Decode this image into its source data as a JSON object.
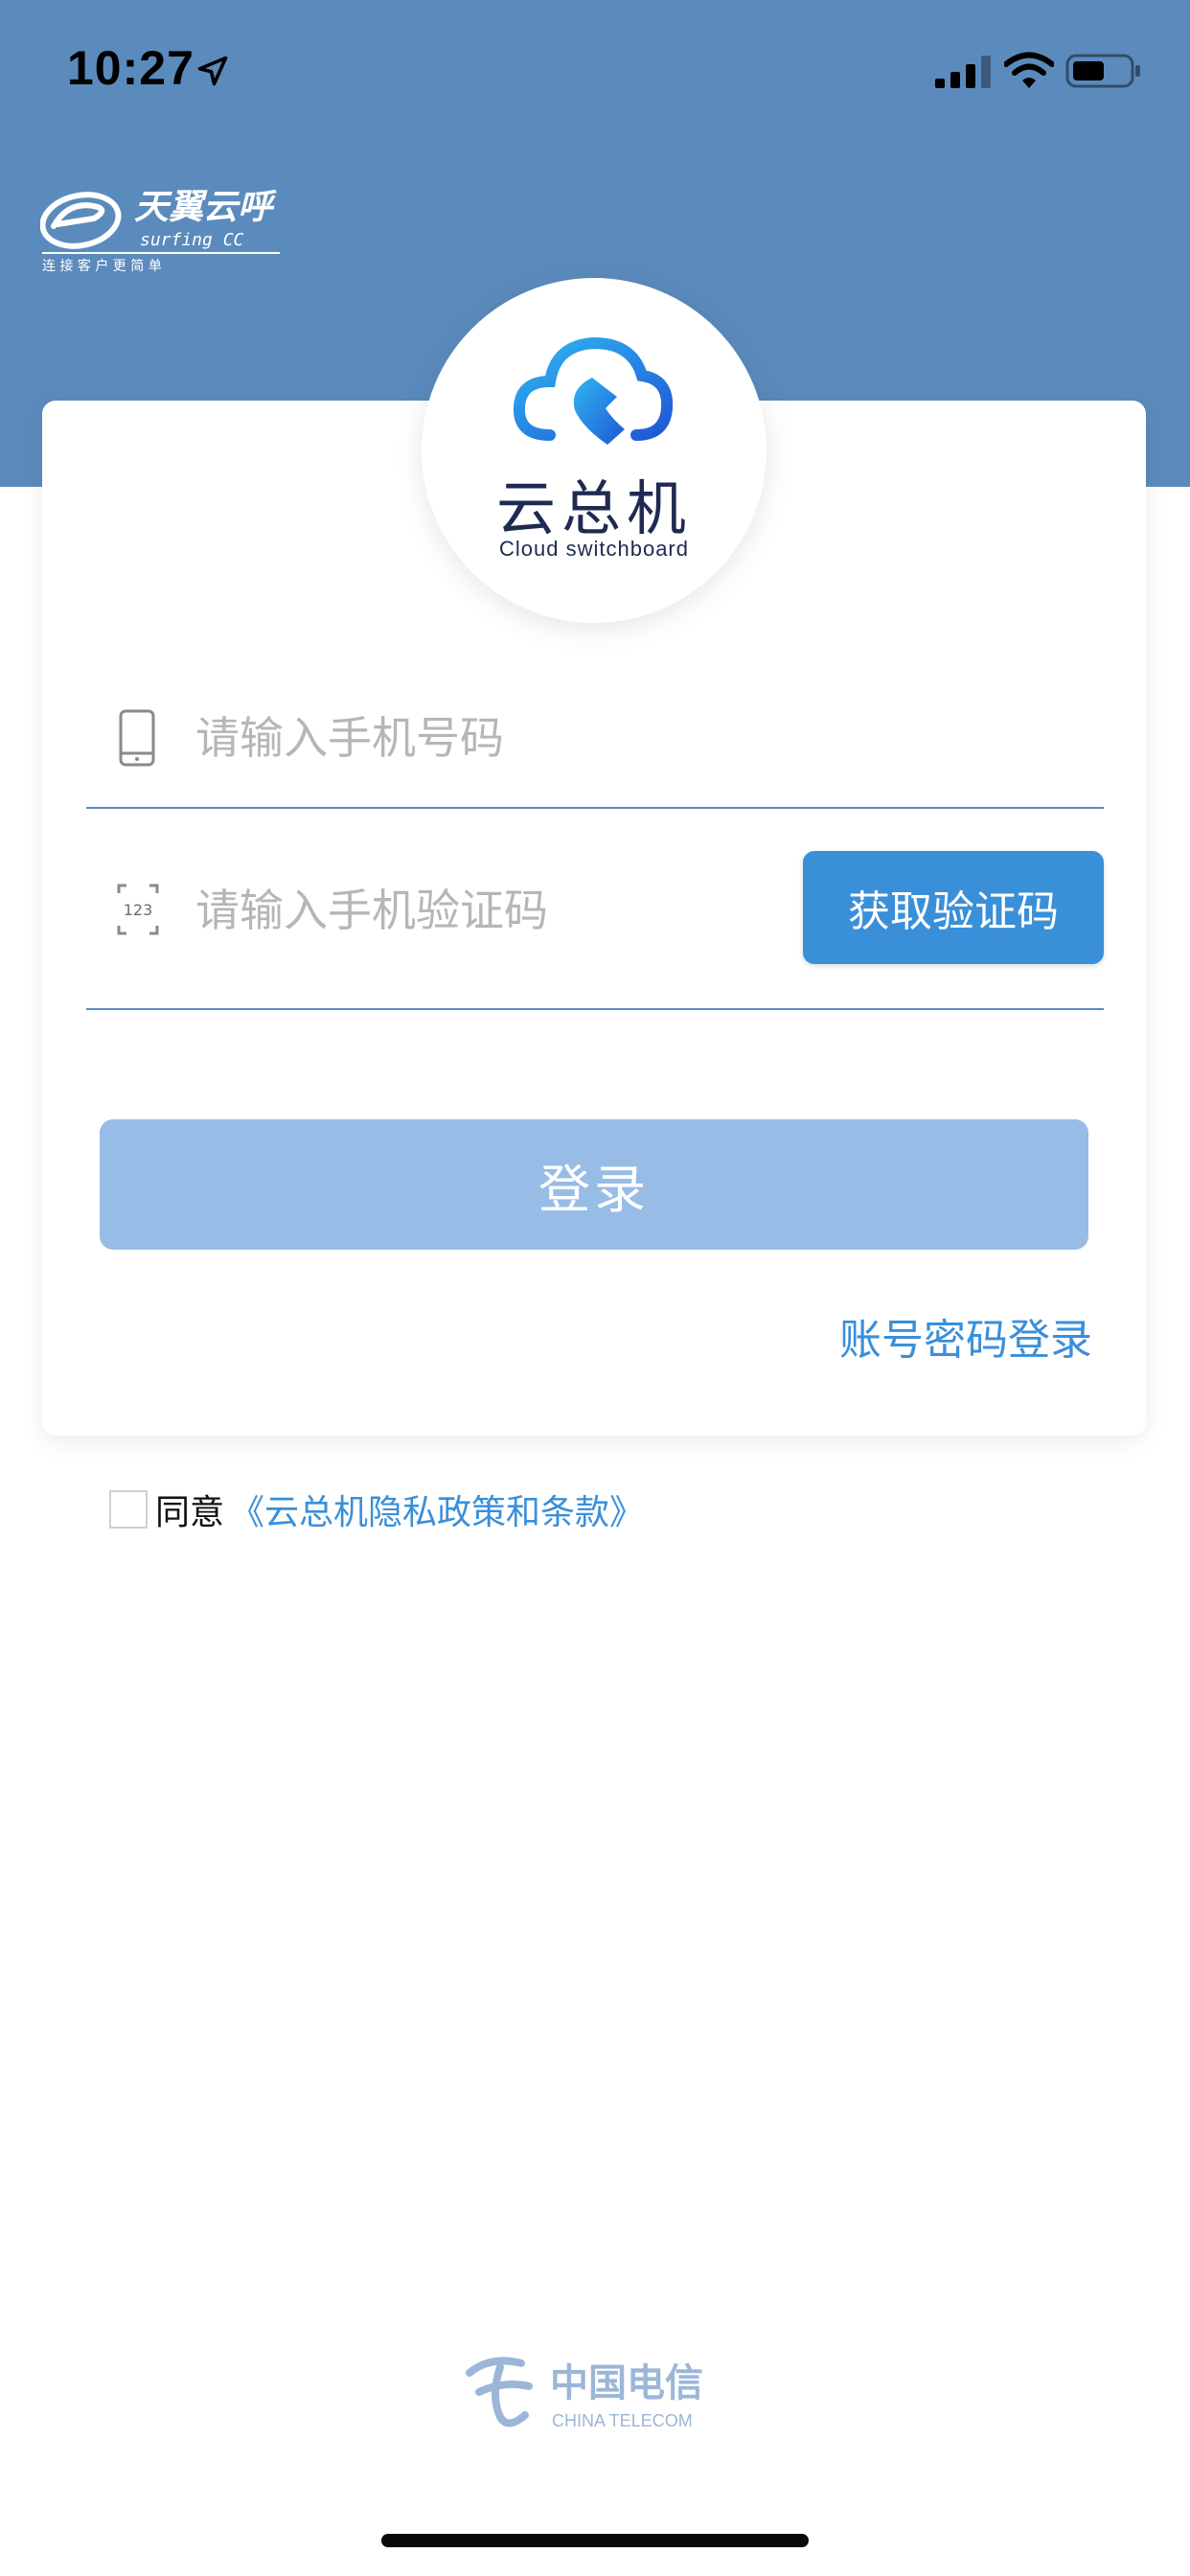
{
  "status_bar": {
    "time": "10:27",
    "location_icon": "location-arrow-icon",
    "signal_icon": "cellular-signal-icon",
    "wifi_icon": "wifi-icon",
    "battery_icon": "battery-icon"
  },
  "brand": {
    "name": "天翼云呼",
    "subtitle": "surfing CC",
    "slogan": "连 接 客 户 更 简 单"
  },
  "app_logo": {
    "icon": "cloud-phone-icon",
    "name": "云总机",
    "subname": "Cloud switchboard"
  },
  "form": {
    "phone_placeholder": "请输入手机号码",
    "phone_icon": "mobile-phone-icon",
    "phone_value": "",
    "code_placeholder": "请输入手机验证码",
    "code_icon": "verification-code-icon",
    "code_icon_text": "123",
    "code_value": "",
    "get_code_label": "获取验证码",
    "login_label": "登录",
    "account_login_label": "账号密码登录"
  },
  "agreement": {
    "checked": false,
    "agree_text": "同意",
    "policy_link": "《云总机隐私政策和条款》"
  },
  "footer": {
    "logo_cn": "中国电信",
    "logo_en": "CHINA TELECOM"
  },
  "colors": {
    "header_bg": "#5b8bbd",
    "accent": "#3a8fd9",
    "login_button_disabled": "#97bce6",
    "divider": "#5b8bbd"
  }
}
